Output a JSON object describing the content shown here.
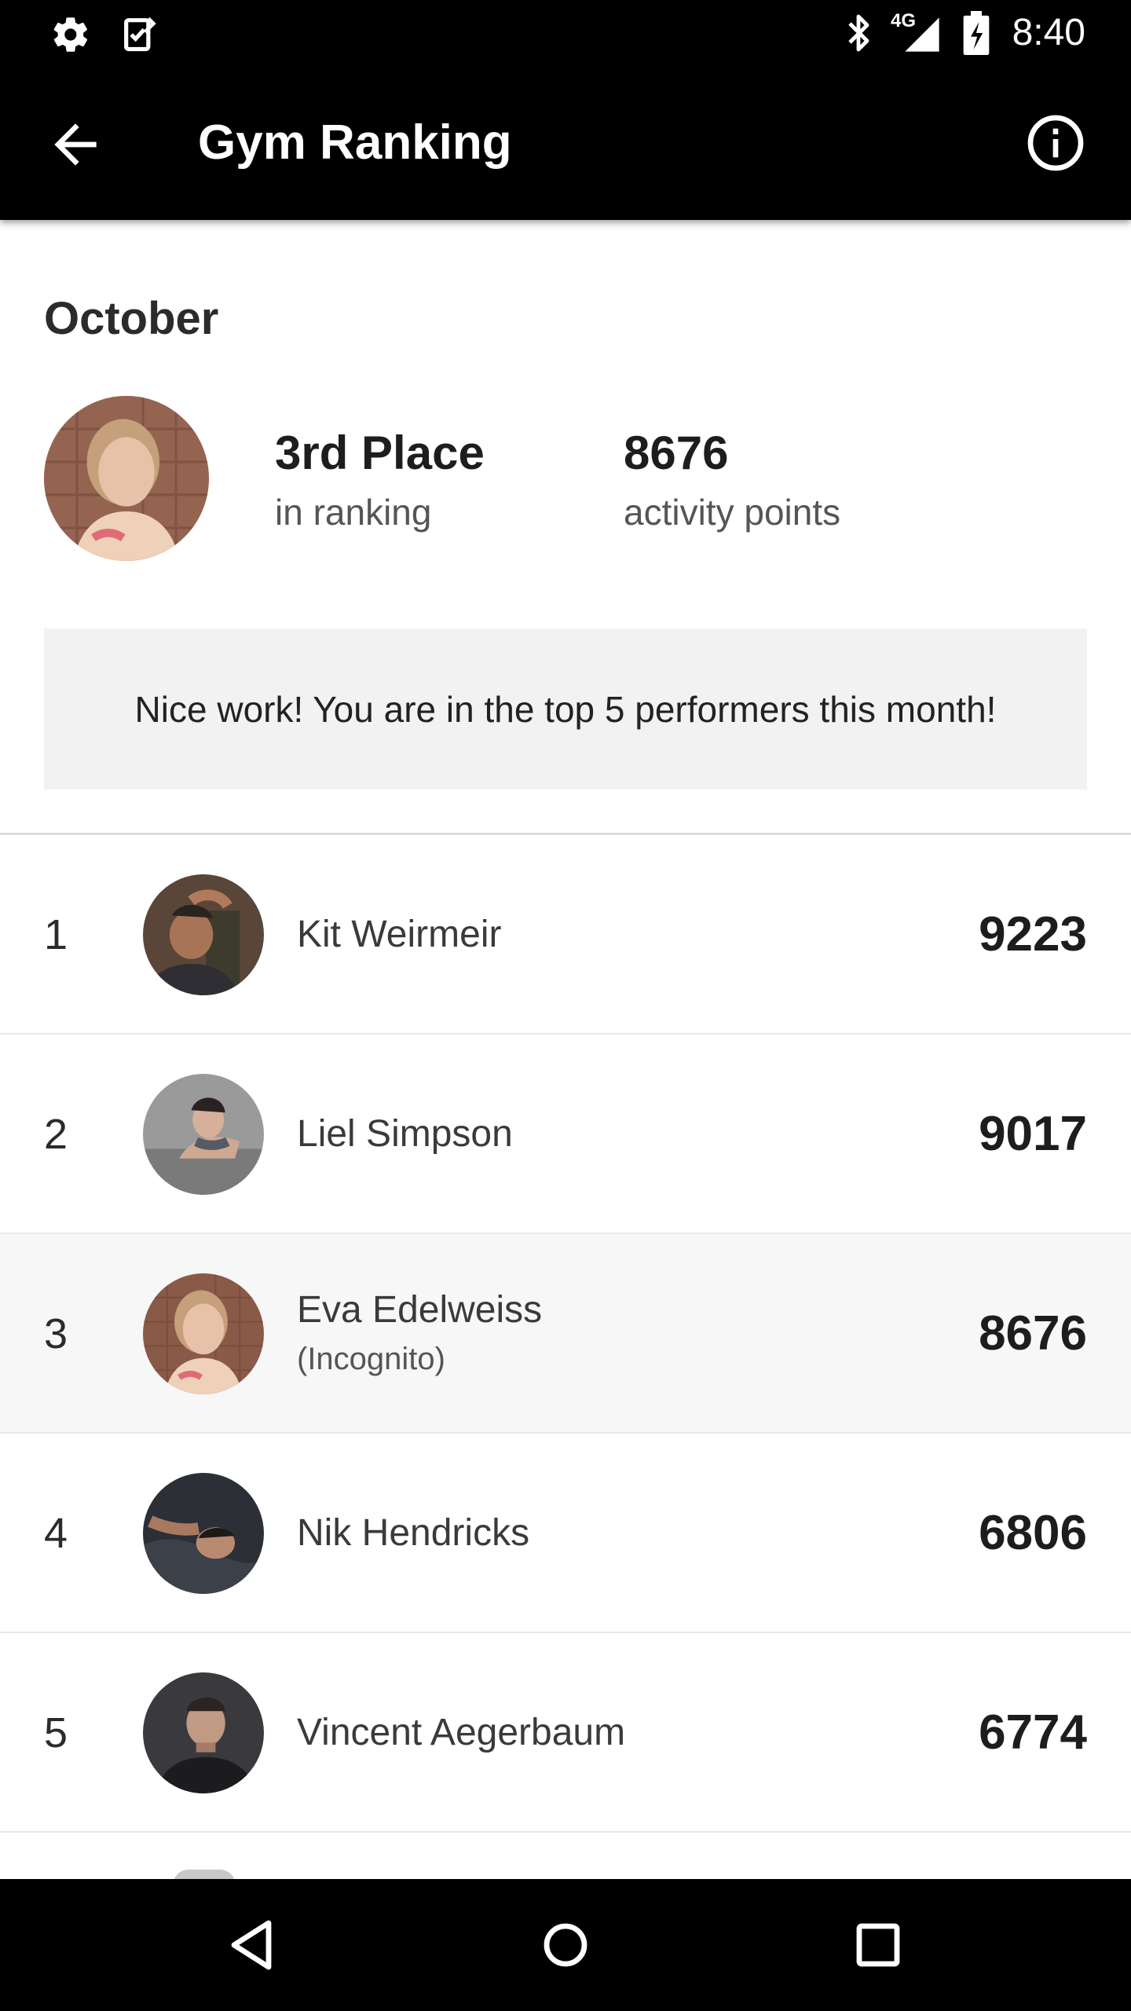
{
  "status_bar": {
    "time": "8:40",
    "network": "4G",
    "icons": [
      "settings-icon",
      "checklist-icon",
      "bluetooth-icon",
      "signal-icon",
      "battery-icon"
    ]
  },
  "toolbar": {
    "title": "Gym Ranking",
    "back_icon": "back-arrow-icon",
    "info_icon": "info-icon"
  },
  "summary": {
    "month": "October",
    "place_value": "3rd Place",
    "place_label": "in ranking",
    "points_value": "8676",
    "points_label": "activity points",
    "notice": "Nice work! You are in the top 5 performers this month!"
  },
  "ranking": [
    {
      "rank": "1",
      "name": "Kit Weirmeir",
      "sub": "",
      "points": "9223"
    },
    {
      "rank": "2",
      "name": "Liel Simpson",
      "sub": "",
      "points": "9017"
    },
    {
      "rank": "3",
      "name": "Eva Edelweiss",
      "sub": "(Incognito)",
      "points": "8676"
    },
    {
      "rank": "4",
      "name": "Nik Hendricks",
      "sub": "",
      "points": "6806"
    },
    {
      "rank": "5",
      "name": "Vincent Aegerbaum",
      "sub": "",
      "points": "6774"
    }
  ],
  "nav_bar": {
    "icons": [
      "back-triangle-icon",
      "home-circle-icon",
      "recents-square-icon"
    ]
  },
  "colors": {
    "bar_background": "#000000",
    "highlight_row": "#f7f7f7",
    "notice_background": "#f2f2f2"
  }
}
